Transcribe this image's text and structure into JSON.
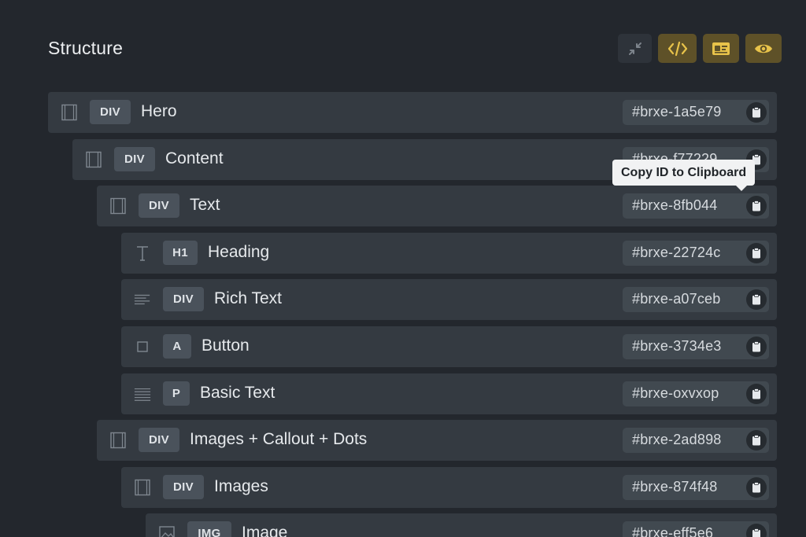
{
  "panel": {
    "title": "Structure"
  },
  "toolbar": {
    "buttons": [
      {
        "icon": "collapse-icon",
        "state": "muted"
      },
      {
        "icon": "code-icon",
        "state": "active"
      },
      {
        "icon": "id-card-icon",
        "state": "active"
      },
      {
        "icon": "eye-icon",
        "state": "active"
      }
    ],
    "accent_color": "#e8c34a"
  },
  "tooltip": {
    "text": "Copy ID to Clipboard"
  },
  "rows": [
    {
      "icon": "container-icon",
      "tag": "DIV",
      "label": "Hero",
      "id": "#brxe-1a5e79",
      "depth": 0
    },
    {
      "icon": "container-icon",
      "tag": "DIV",
      "label": "Content",
      "id": "#brxe-f77229",
      "depth": 1
    },
    {
      "icon": "container-icon",
      "tag": "DIV",
      "label": "Text",
      "id": "#brxe-8fb044",
      "depth": 2
    },
    {
      "icon": "heading-icon",
      "tag": "H1",
      "label": "Heading",
      "id": "#brxe-22724c",
      "depth": 3
    },
    {
      "icon": "rich-text-icon",
      "tag": "DIV",
      "label": "Rich Text",
      "id": "#brxe-a07ceb",
      "depth": 3
    },
    {
      "icon": "button-icon",
      "tag": "A",
      "label": "Button",
      "id": "#brxe-3734e3",
      "depth": 3
    },
    {
      "icon": "text-lines-icon",
      "tag": "P",
      "label": "Basic Text",
      "id": "#brxe-oxvxop",
      "depth": 3
    },
    {
      "icon": "container-icon",
      "tag": "DIV",
      "label": "Images + Callout + Dots",
      "id": "#brxe-2ad898",
      "depth": 2
    },
    {
      "icon": "container-icon",
      "tag": "DIV",
      "label": "Images",
      "id": "#brxe-874f48",
      "depth": 3
    },
    {
      "icon": "image-icon",
      "tag": "IMG",
      "label": "Image",
      "id": "#brxe-eff5e6",
      "depth": 4
    }
  ]
}
